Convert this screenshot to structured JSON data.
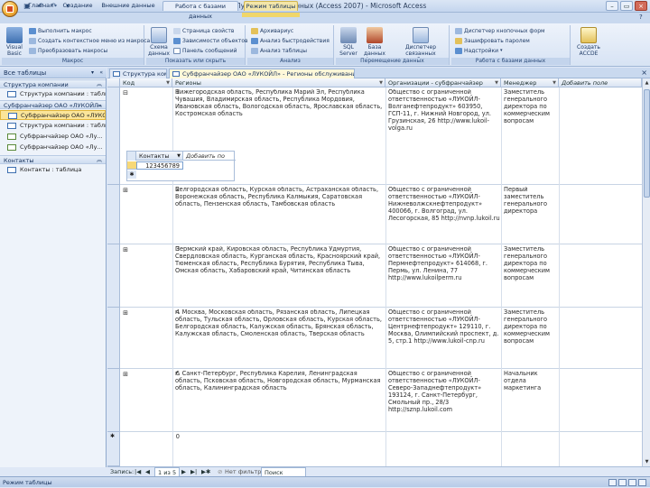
{
  "window": {
    "title": "НК Лукойл : база данных (Access 2007) - Microsoft Access"
  },
  "ribbon_tabs": [
    "Главная",
    "Создание",
    "Внешние данные",
    "Работа с базами данных",
    "Режим таблицы"
  ],
  "ribbon": {
    "macros_group": {
      "label": "Макрос",
      "big": "Visual Basic",
      "items": [
        "Выполнить макрос",
        "Создать контекстное меню из макроса",
        "Преобразовать макросы"
      ]
    },
    "show_group": {
      "label": "Показать или скрыть",
      "big": "Схема данных",
      "items": [
        "Страница свойств",
        "Зависимости объектов",
        "Панель сообщений"
      ]
    },
    "analysis_group": {
      "label": "Анализ",
      "items": [
        "Архивариус",
        "Анализ быстродействия",
        "Анализ таблицы"
      ]
    },
    "move_group": {
      "label": "Перемещение данных",
      "big1": "SQL Server",
      "big2": "База данных Access",
      "big3": "Диспетчер связанных таблиц"
    },
    "tools_group": {
      "label": "Работа с базами данных",
      "items": [
        "Диспетчер кнопочных форм",
        "Зашифровать паролем",
        "Надстройки"
      ],
      "big": "Создать ACCDE"
    }
  },
  "nav": {
    "header": "Все таблицы",
    "sections": [
      {
        "title": "Структура компании",
        "items": [
          "Структура компании : таблица"
        ]
      },
      {
        "title": "Субфранчайзер ОАО «ЛУКОЙЛ»",
        "items": [
          "Субфранчайзер ОАО «ЛУКОЙЛ»: таблица",
          "Структура компании : таблица",
          "Субфранчайзер ОАО «Лу...",
          "Субфранчайзер ОАО «Лу..."
        ]
      },
      {
        "title": "Контакты",
        "items": [
          "Контакты : таблица"
        ]
      }
    ]
  },
  "doc_tabs": [
    "Структура компании",
    "Субфранчайзер ОАО «ЛУКОЙЛ» - Регионы обслуживания"
  ],
  "columns": [
    "Код",
    "Регионы",
    "Организации - субфранчайзер",
    "Менеджер",
    "Добавить поле"
  ],
  "rows": [
    {
      "code": "1",
      "regions": "Нижегородская область, Республика Марий Эл, Республика Чувашия, Владимирская область, Республика Мордовия, Ивановская область, Вологодская область, Ярославская область, Костромская область",
      "org": "Общество с ограниченной ответственностью «ЛУКОЙЛ-Волганефтепродукт» 603950, ГСП-11, г. Нижний Новгород, ул. Грузинская, 26 http://www.lukoil-volga.ru",
      "manager": "Заместитель генерального директора по коммерческим вопросам",
      "expanded": true
    },
    {
      "code": "2",
      "regions": "Белгородская область, Курская область, Астраханская область, Воронежская область, Республика Калмыкия, Саратовская область, Пензенская область, Тамбовская область",
      "org": "Общество с ограниченной ответственностью «ЛУКОЙЛ-Нижневолжскнефтепродукт» 400066, г. Волгоград, ул. Лесогорская, 85 http://nvnp.lukoil.ru",
      "manager": "Первый заместитель генерального директора",
      "expanded": false
    },
    {
      "code": "3",
      "regions": "Пермский край, Кировская область, Республика Удмуртия, Свердловская область, Курганская область, Красноярский край, Тюменская область, Республика Бурятия, Республика Тыва, Омская область, Хабаровский край, Читинская область",
      "org": "Общество с ограниченной ответственностью «ЛУКОЙЛ-Пермнефтепродукт» 614068, г. Пермь, ул. Ленина, 77 http://www.lukoilperm.ru",
      "manager": "Заместитель генерального директора по коммерческим вопросам",
      "expanded": false
    },
    {
      "code": "4",
      "regions": "г. Москва, Московская область, Рязанская область, Липецкая область, Тульская область, Орловская область, Курская область, Белгородская область, Калужская область, Брянская область, Калужская область, Смоленская область, Тверская область",
      "org": "Общество с ограниченной ответственностью «ЛУКОЙЛ-Центрнефтепродукт» 129110, г. Москва, Олимпийский проспект, д. 5, стр.1 http://www.lukoil-cnp.ru",
      "manager": "Заместитель генерального директора по коммерческим вопросам",
      "expanded": false
    },
    {
      "code": "6",
      "regions": "г. Санкт-Петербург, Республика Карелия, Ленинградская область, Псковская область, Новгородская область, Мурманская область, Калининградская область",
      "org": "Общество с ограниченной ответственностью «ЛУКОЙЛ-Северо-Западнефтепродукт» 193124, г. Санкт-Петербург, Смольный пр., 28/3 http://sznp.lukoil.com",
      "manager": "Начальник отдела маркетинга",
      "expanded": false
    },
    {
      "code": "0",
      "regions": "",
      "org": "",
      "manager": "",
      "expanded": false
    }
  ],
  "subdatasheet": {
    "column": "Контакты",
    "add": "Добавить по",
    "value": "123456789"
  },
  "record_nav": {
    "label": "Запись:",
    "position": "1 из 5",
    "filter": "Нет фильтра",
    "search": "Поиск"
  },
  "status": {
    "text": "Режим таблицы"
  }
}
